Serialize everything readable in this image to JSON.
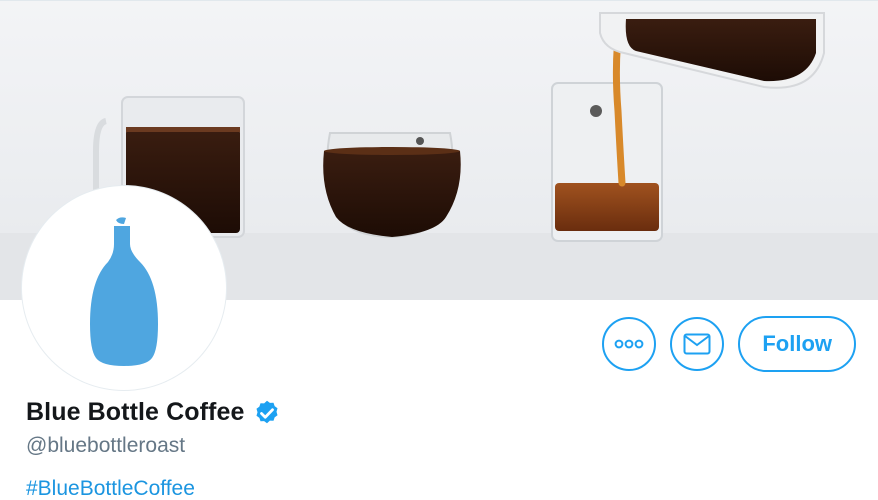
{
  "profile": {
    "display_name": "Blue Bottle Coffee",
    "handle": "@bluebottleroast",
    "bio_hashtag": "#BlueBottleCoffee",
    "verified": true
  },
  "actions": {
    "more_icon": "more-icon",
    "message_icon": "envelope-icon",
    "follow_label": "Follow"
  },
  "colors": {
    "accent": "#1da1f2",
    "link": "#1b95e0",
    "name": "#14171a",
    "handle": "#657786",
    "logo_blue": "#4fa6e0"
  }
}
